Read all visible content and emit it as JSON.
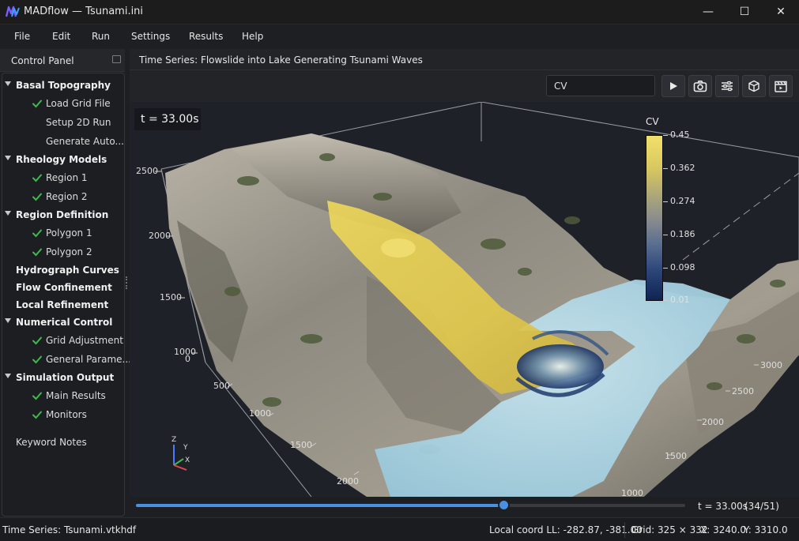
{
  "window": {
    "title": "MADflow — Tsunami.ini",
    "minimize_glyph": "—",
    "maximize_glyph": "☐",
    "close_glyph": "✕"
  },
  "menu": [
    "File",
    "Edit",
    "Run",
    "Settings",
    "Results",
    "Help"
  ],
  "control_panel": {
    "title": "Control Panel",
    "tree": [
      {
        "label": "Basal Topography",
        "level": 0,
        "expanded": true
      },
      {
        "label": "Load Grid File",
        "level": 1,
        "checked": true
      },
      {
        "label": "Setup 2D Run",
        "level": 1,
        "checked": false
      },
      {
        "label": "Generate Auto...",
        "level": 1,
        "checked": false
      },
      {
        "label": "Rheology Models",
        "level": 0,
        "expanded": true
      },
      {
        "label": "Region 1",
        "level": 1,
        "checked": true
      },
      {
        "label": "Region 2",
        "level": 1,
        "checked": true
      },
      {
        "label": "Region Definition",
        "level": 0,
        "expanded": true
      },
      {
        "label": "Polygon 1",
        "level": 1,
        "checked": true
      },
      {
        "label": "Polygon 2",
        "level": 1,
        "checked": true
      },
      {
        "label": "Hydrograph Curves",
        "level": 0,
        "expanded": false
      },
      {
        "label": "Flow Confinement",
        "level": 0,
        "expanded": false
      },
      {
        "label": "Local Refinement",
        "level": 0,
        "expanded": false
      },
      {
        "label": "Numerical Control",
        "level": 0,
        "expanded": true
      },
      {
        "label": "Grid Adjustment",
        "level": 1,
        "checked": true
      },
      {
        "label": "General Parame...",
        "level": 1,
        "checked": true
      },
      {
        "label": "Simulation Output",
        "level": 0,
        "expanded": true
      },
      {
        "label": "Main Results",
        "level": 1,
        "checked": true
      },
      {
        "label": "Monitors",
        "level": 1,
        "checked": true
      },
      {
        "label": "Keyword Notes",
        "level": 2,
        "checked": false
      }
    ]
  },
  "main": {
    "title": "Time Series: Flowslide into Lake Generating Tsunami Waves",
    "variable_field": "CV",
    "toolbar_icons": [
      "play-icon",
      "camera-icon",
      "sliders-icon",
      "cube-icon",
      "clapperboard-icon"
    ]
  },
  "viewport": {
    "time_label": "t = 33.00s",
    "colorbar": {
      "title": "CV",
      "ticks": [
        "0.45",
        "0.362",
        "0.274",
        "0.186",
        "0.098",
        "0.01"
      ]
    },
    "axis_z_ticks": [
      "2500",
      "2000",
      "1500",
      "1000",
      "0"
    ],
    "axis_x_ticks": [
      "500",
      "1000",
      "1500",
      "2000"
    ],
    "axis_y_ticks": [
      "3000",
      "2500",
      "2000",
      "1500",
      "1000"
    ],
    "orientation": {
      "z": "Z",
      "y": "Y",
      "x": "X"
    }
  },
  "timeline": {
    "progress": 0.67,
    "time": "t = 33.00s",
    "frame": "(34/51)"
  },
  "status": {
    "file": "Time Series: Tsunami.vtkhdf",
    "coord": "Local coord LL: -282.87, -381.00",
    "grid": "Grid: 325 × 332",
    "x": "X: 3240.0",
    "y": "Y: 3310.0"
  },
  "colors": {
    "accent": "#4a90e2",
    "check": "#3fb950",
    "flow": "#e6cf4a",
    "water": "#a9d3e3"
  }
}
